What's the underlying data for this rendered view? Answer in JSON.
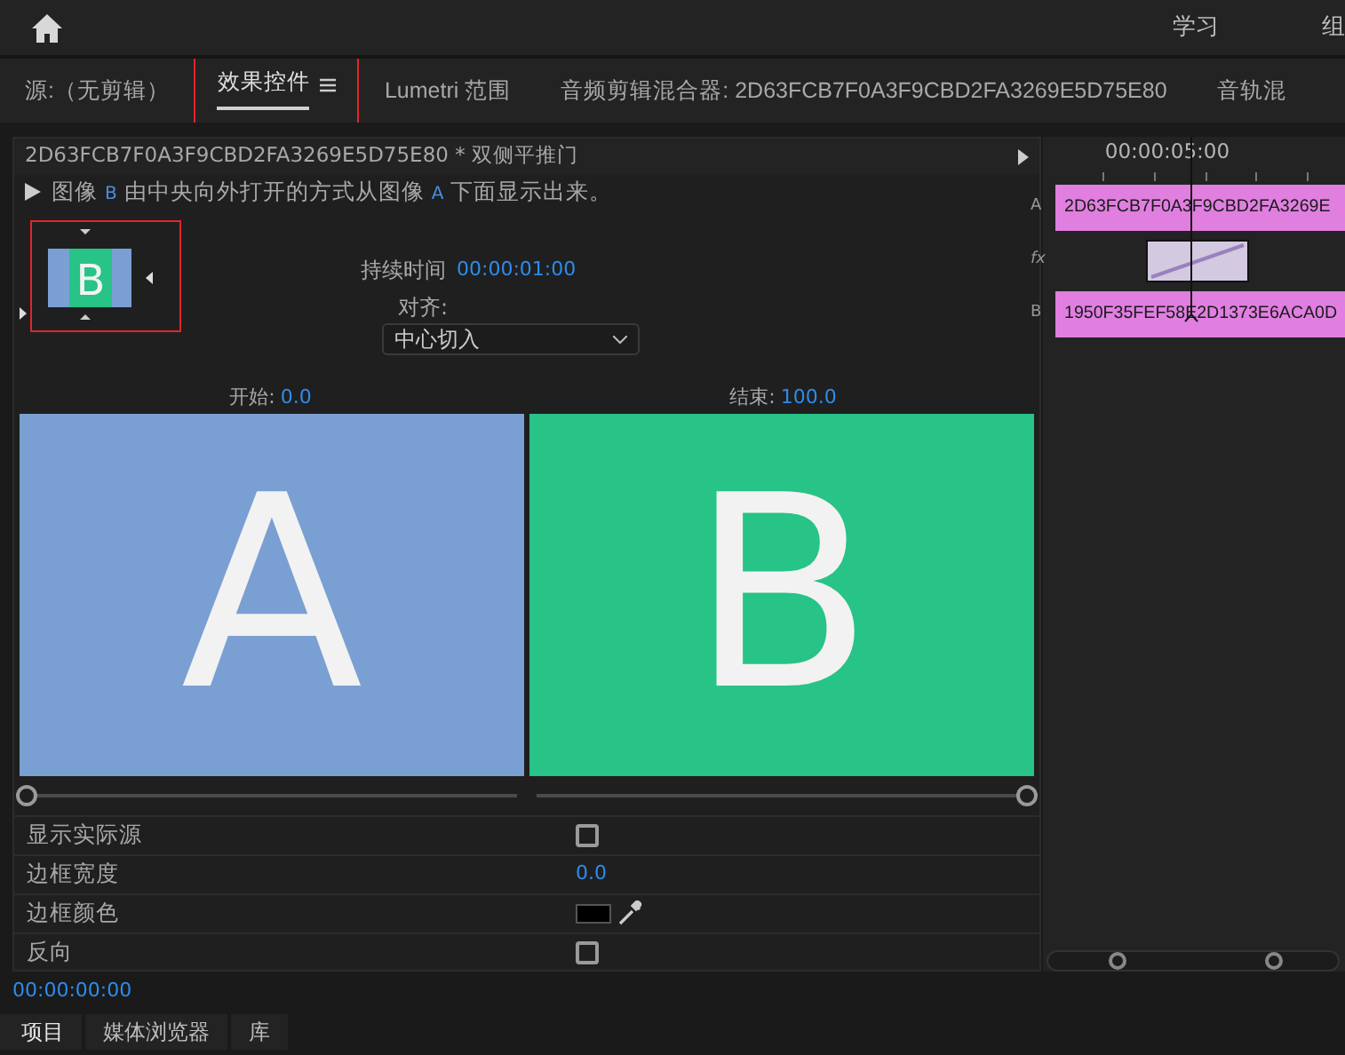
{
  "top_bar": {
    "workspaces": [
      "学习",
      "组"
    ]
  },
  "tabs": [
    {
      "label": "源:（无剪辑）",
      "selected": false,
      "menu": false
    },
    {
      "label": "效果控件",
      "selected": true,
      "menu": true
    },
    {
      "label": "Lumetri 范围",
      "selected": false,
      "menu": false
    },
    {
      "label": "音频剪辑混合器: 2D63FCB7F0A3F9CBD2FA3269E5D75E80",
      "selected": false,
      "menu": false
    },
    {
      "label": "音轨混",
      "selected": false,
      "menu": false
    }
  ],
  "effect_panel": {
    "clip_title": "2D63FCB7F0A3F9CBD2FA3269E5D75E80 * 双侧平推门",
    "description": [
      {
        "kind": "plain",
        "text": "图像 "
      },
      {
        "kind": "letter",
        "text": "B"
      },
      {
        "kind": "plain",
        "text": " 由中央向外打开的方式从图像 "
      },
      {
        "kind": "letter",
        "text": "A"
      },
      {
        "kind": "plain",
        "text": " 下面显示出来。"
      }
    ],
    "thumbnail_letter": "B",
    "duration_label": "持续时间",
    "duration": "00:00:01:00",
    "alignment_label": "对齐:",
    "alignment": "中心切入",
    "start": {
      "label": "开始:",
      "value": "0.0",
      "level": 0,
      "letter": "A"
    },
    "end": {
      "label": "结束:",
      "value": "100.0",
      "level": 1,
      "letter": "B"
    },
    "properties": [
      {
        "kind": "checkbox",
        "label": "显示实际源",
        "checked": false
      },
      {
        "kind": "number",
        "label": "边框宽度",
        "value": "0.0"
      },
      {
        "kind": "color",
        "label": "边框颜色",
        "color": "#000000"
      },
      {
        "kind": "checkbox",
        "label": "反向",
        "checked": false
      }
    ],
    "timecode": "00:00:00:00"
  },
  "timeline": {
    "time": "00:00:05:00",
    "track_labels": [
      "A",
      "fx",
      "B"
    ],
    "clip_a": "2D63FCB7F0A3F9CBD2FA3269E",
    "clip_b": "1950F35FEF58E2D1373E6ACA0D"
  },
  "bottom_tabs": [
    {
      "label": "项目",
      "selected": true
    },
    {
      "label": "媒体浏览器",
      "selected": false
    },
    {
      "label": "库",
      "selected": false
    }
  ]
}
